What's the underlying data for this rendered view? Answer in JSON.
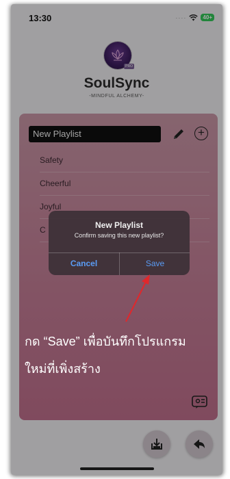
{
  "status_bar": {
    "time": "13:30",
    "battery": "40+"
  },
  "app": {
    "title": "SoulSync",
    "subtitle": "-MINDFUL ALCHEMY-",
    "logo_badge": "PRO"
  },
  "playlist_editor": {
    "name_value": "New Playlist",
    "items": [
      "Safety",
      "Cheerful",
      "Joyful",
      "C"
    ]
  },
  "dialog": {
    "title": "New Playlist",
    "message": "Confirm saving this new playlist?",
    "cancel_label": "Cancel",
    "save_label": "Save"
  },
  "annotation": {
    "line1": "กด “Save” เพื่อบันทึกโปรแกรม",
    "line2": "ใหม่ที่เพิ่งสร้าง"
  },
  "icons": {
    "edit": "pencil-icon",
    "add": "plus-circle-icon",
    "caption": "caption-icon",
    "download": "download-icon",
    "back": "back-icon",
    "wifi": "wifi-icon"
  },
  "colors": {
    "card_top": "#c896a6",
    "card_bottom": "#bf6f8c",
    "dialog_button": "#5a9cf5",
    "arrow": "#e0282c",
    "annotation_text": "#ffffff"
  }
}
